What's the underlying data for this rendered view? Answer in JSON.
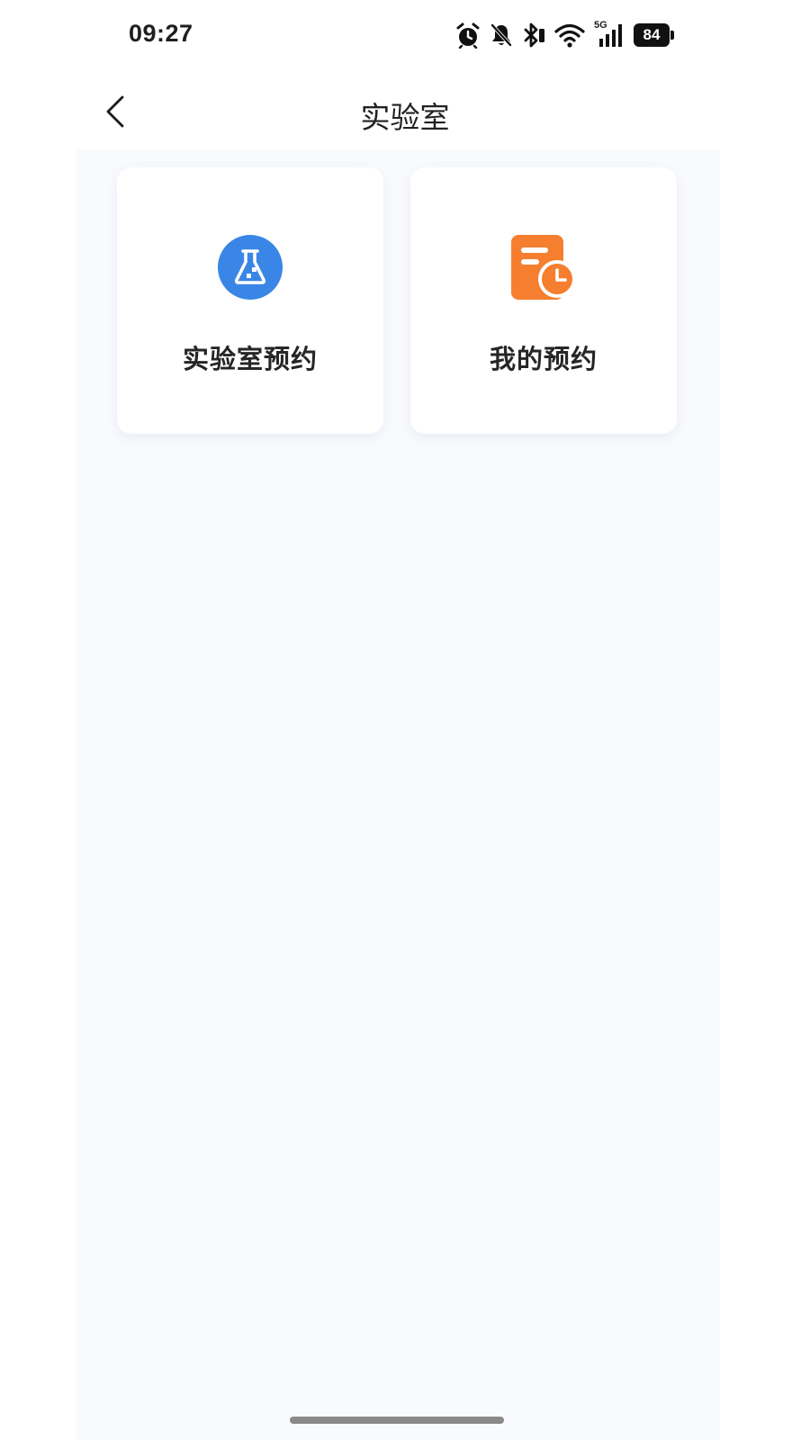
{
  "status_bar": {
    "time": "09:27",
    "network": "5G",
    "battery": "84",
    "icons": [
      "alarm-icon",
      "mute-bell-icon",
      "bluetooth-icon",
      "wifi-icon",
      "cellular-5g-icon",
      "battery-icon"
    ]
  },
  "nav": {
    "back_icon": "chevron-left-icon",
    "title": "实验室"
  },
  "cards": [
    {
      "label": "实验室预约",
      "icon": "flask-icon",
      "icon_color": "#3a86e6"
    },
    {
      "label": "我的预约",
      "icon": "schedule-document-icon",
      "icon_color": "#f57f2f"
    }
  ],
  "colors": {
    "content_bg": "#f9fafd",
    "card_bg": "#ffffff",
    "home_indicator": "#8a8a8a"
  }
}
